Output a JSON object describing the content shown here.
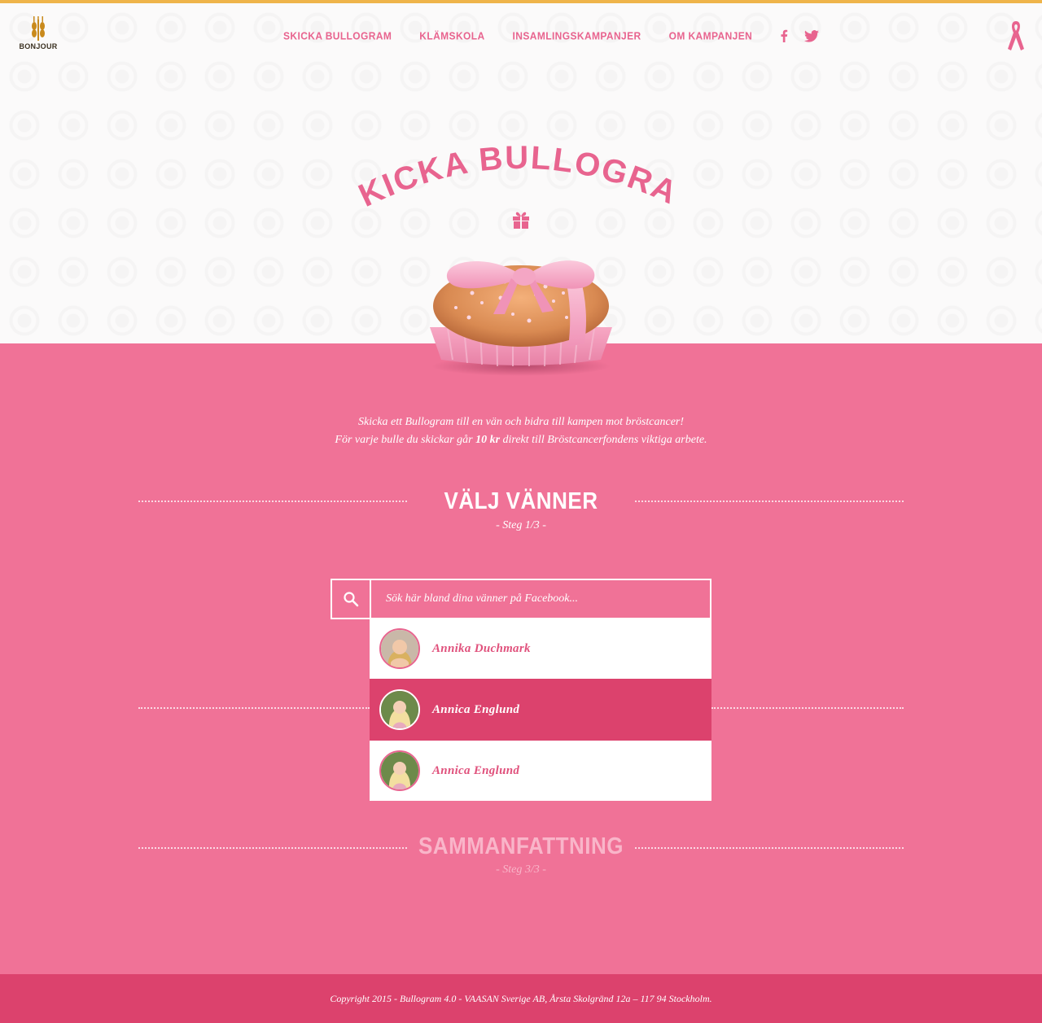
{
  "brand": {
    "logo_text": "BONJOUR",
    "accent_color": "#f07297",
    "dark_pink": "#dc426d",
    "top_bar_color": "#efb44a"
  },
  "nav": {
    "items": [
      "SKICKA BULLOGRAM",
      "KLÄMSKOLA",
      "INSAMLINGSKAMPANJER",
      "OM KAMPANJEN"
    ],
    "social_icons": [
      "facebook-icon",
      "twitter-icon"
    ]
  },
  "hero": {
    "title": "SKICKA BULLOGRAM",
    "gift_icon": "gift-icon",
    "image": "pink bun with ribbon"
  },
  "intro": {
    "line1": "Skicka ett Bullogram till en vän och bidra till kampen mot bröstcancer!",
    "line2_before": "För varje bulle du skickar går ",
    "line2_bold": "10 kr",
    "line2_after": " direkt till Bröstcancerfondens viktiga arbete."
  },
  "step1": {
    "title": "VÄLJ VÄNNER",
    "subtitle": "- Steg 1/3 -"
  },
  "search": {
    "placeholder": "Sök här bland dina vänner på Facebook...",
    "icon": "search-icon"
  },
  "results": [
    {
      "name": "Annika Duchmark",
      "active": false
    },
    {
      "name": "Annica Englund",
      "active": true
    },
    {
      "name": "Annica Englund",
      "active": false
    }
  ],
  "step3": {
    "title": "SAMMANFATTNING",
    "subtitle": "- Steg 3/3 -"
  },
  "footer": {
    "copyright": "Copyright 2015 - Bullogram 4.0 - VAASAN Sverige AB, Årsta Skolgränd 12a – 117 94 Stockholm."
  }
}
